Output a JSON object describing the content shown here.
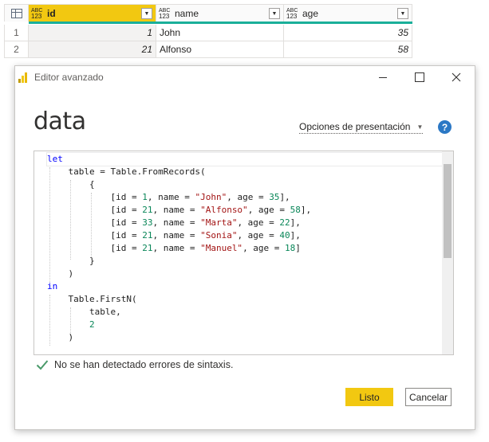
{
  "grid": {
    "columns": [
      {
        "name": "id",
        "type_top": "ABC",
        "type_bottom": "123"
      },
      {
        "name": "name",
        "type_top": "ABC",
        "type_bottom": "123"
      },
      {
        "name": "age",
        "type_top": "ABC",
        "type_bottom": "123"
      }
    ],
    "filter_glyph": "▼",
    "rows": [
      {
        "index": "1",
        "id": "1",
        "name": "John",
        "age": "35"
      },
      {
        "index": "2",
        "id": "21",
        "name": "Alfonso",
        "age": "58"
      }
    ]
  },
  "dialog": {
    "title": "Editor avanzado",
    "query_name": "data",
    "view_options_label": "Opciones de presentación",
    "help_label": "?",
    "code_lines": [
      {
        "parts": [
          {
            "t": "let",
            "c": "kw"
          }
        ]
      },
      {
        "parts": [
          {
            "t": "    table = Table.FromRecords(",
            "c": ""
          }
        ]
      },
      {
        "parts": [
          {
            "t": "        {",
            "c": ""
          }
        ]
      },
      {
        "parts": [
          {
            "t": "            [id = ",
            "c": ""
          },
          {
            "t": "1",
            "c": "num"
          },
          {
            "t": ", name = ",
            "c": ""
          },
          {
            "t": "\"John\"",
            "c": "str"
          },
          {
            "t": ", age = ",
            "c": ""
          },
          {
            "t": "35",
            "c": "num"
          },
          {
            "t": "],",
            "c": ""
          }
        ]
      },
      {
        "parts": [
          {
            "t": "            [id = ",
            "c": ""
          },
          {
            "t": "21",
            "c": "num"
          },
          {
            "t": ", name = ",
            "c": ""
          },
          {
            "t": "\"Alfonso\"",
            "c": "str"
          },
          {
            "t": ", age = ",
            "c": ""
          },
          {
            "t": "58",
            "c": "num"
          },
          {
            "t": "],",
            "c": ""
          }
        ]
      },
      {
        "parts": [
          {
            "t": "            [id = ",
            "c": ""
          },
          {
            "t": "33",
            "c": "num"
          },
          {
            "t": ", name = ",
            "c": ""
          },
          {
            "t": "\"Marta\"",
            "c": "str"
          },
          {
            "t": ", age = ",
            "c": ""
          },
          {
            "t": "22",
            "c": "num"
          },
          {
            "t": "],",
            "c": ""
          }
        ]
      },
      {
        "parts": [
          {
            "t": "            [id = ",
            "c": ""
          },
          {
            "t": "21",
            "c": "num"
          },
          {
            "t": ", name = ",
            "c": ""
          },
          {
            "t": "\"Sonia\"",
            "c": "str"
          },
          {
            "t": ", age = ",
            "c": ""
          },
          {
            "t": "40",
            "c": "num"
          },
          {
            "t": "],",
            "c": ""
          }
        ]
      },
      {
        "parts": [
          {
            "t": "            [id = ",
            "c": ""
          },
          {
            "t": "21",
            "c": "num"
          },
          {
            "t": ", name = ",
            "c": ""
          },
          {
            "t": "\"Manuel\"",
            "c": "str"
          },
          {
            "t": ", age = ",
            "c": ""
          },
          {
            "t": "18",
            "c": "num"
          },
          {
            "t": "]",
            "c": ""
          }
        ]
      },
      {
        "parts": [
          {
            "t": "        }",
            "c": ""
          }
        ]
      },
      {
        "parts": [
          {
            "t": "    )",
            "c": ""
          }
        ]
      },
      {
        "parts": [
          {
            "t": "in",
            "c": "kw"
          }
        ]
      },
      {
        "parts": [
          {
            "t": "    Table.FirstN(",
            "c": ""
          }
        ]
      },
      {
        "parts": [
          {
            "t": "        table,",
            "c": ""
          }
        ]
      },
      {
        "parts": [
          {
            "t": "        ",
            "c": ""
          },
          {
            "t": "2",
            "c": "num"
          }
        ]
      },
      {
        "parts": [
          {
            "t": "    )",
            "c": ""
          }
        ]
      }
    ],
    "status_text": "No se han detectado errores de sintaxis.",
    "ok_label": "Listo",
    "cancel_label": "Cancelar"
  },
  "colors": {
    "accent": "#f2c811",
    "keyword": "#0000ff",
    "string": "#a31515",
    "number": "#098658",
    "success": "#4a9a6a",
    "column_quality": "#1aaf9a",
    "help": "#2b78c5"
  },
  "icons": [
    "table-icon",
    "filter-icon",
    "powerbi-app-icon",
    "minimize-icon",
    "maximize-icon",
    "close-icon",
    "help-icon",
    "check-icon",
    "chevron-down-icon"
  ]
}
